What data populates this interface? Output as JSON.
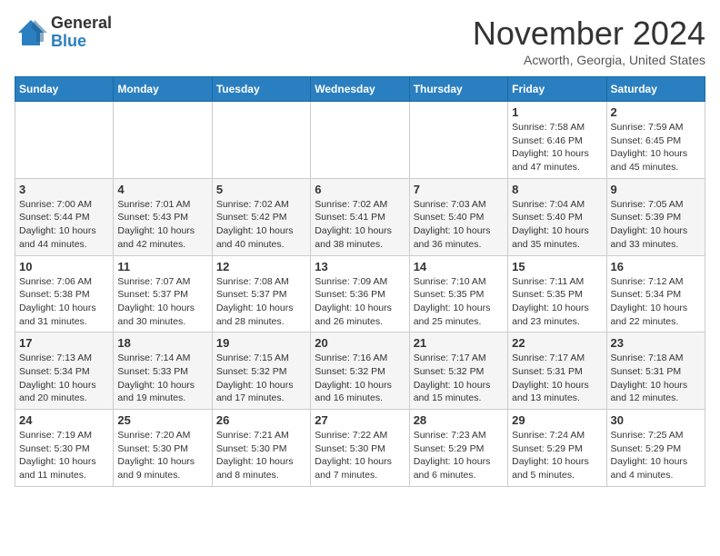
{
  "logo": {
    "general": "General",
    "blue": "Blue"
  },
  "title": "November 2024",
  "location": "Acworth, Georgia, United States",
  "weekdays": [
    "Sunday",
    "Monday",
    "Tuesday",
    "Wednesday",
    "Thursday",
    "Friday",
    "Saturday"
  ],
  "weeks": [
    [
      {
        "day": "",
        "info": ""
      },
      {
        "day": "",
        "info": ""
      },
      {
        "day": "",
        "info": ""
      },
      {
        "day": "",
        "info": ""
      },
      {
        "day": "",
        "info": ""
      },
      {
        "day": "1",
        "info": "Sunrise: 7:58 AM\nSunset: 6:46 PM\nDaylight: 10 hours and 47 minutes."
      },
      {
        "day": "2",
        "info": "Sunrise: 7:59 AM\nSunset: 6:45 PM\nDaylight: 10 hours and 45 minutes."
      }
    ],
    [
      {
        "day": "3",
        "info": "Sunrise: 7:00 AM\nSunset: 5:44 PM\nDaylight: 10 hours and 44 minutes."
      },
      {
        "day": "4",
        "info": "Sunrise: 7:01 AM\nSunset: 5:43 PM\nDaylight: 10 hours and 42 minutes."
      },
      {
        "day": "5",
        "info": "Sunrise: 7:02 AM\nSunset: 5:42 PM\nDaylight: 10 hours and 40 minutes."
      },
      {
        "day": "6",
        "info": "Sunrise: 7:02 AM\nSunset: 5:41 PM\nDaylight: 10 hours and 38 minutes."
      },
      {
        "day": "7",
        "info": "Sunrise: 7:03 AM\nSunset: 5:40 PM\nDaylight: 10 hours and 36 minutes."
      },
      {
        "day": "8",
        "info": "Sunrise: 7:04 AM\nSunset: 5:40 PM\nDaylight: 10 hours and 35 minutes."
      },
      {
        "day": "9",
        "info": "Sunrise: 7:05 AM\nSunset: 5:39 PM\nDaylight: 10 hours and 33 minutes."
      }
    ],
    [
      {
        "day": "10",
        "info": "Sunrise: 7:06 AM\nSunset: 5:38 PM\nDaylight: 10 hours and 31 minutes."
      },
      {
        "day": "11",
        "info": "Sunrise: 7:07 AM\nSunset: 5:37 PM\nDaylight: 10 hours and 30 minutes."
      },
      {
        "day": "12",
        "info": "Sunrise: 7:08 AM\nSunset: 5:37 PM\nDaylight: 10 hours and 28 minutes."
      },
      {
        "day": "13",
        "info": "Sunrise: 7:09 AM\nSunset: 5:36 PM\nDaylight: 10 hours and 26 minutes."
      },
      {
        "day": "14",
        "info": "Sunrise: 7:10 AM\nSunset: 5:35 PM\nDaylight: 10 hours and 25 minutes."
      },
      {
        "day": "15",
        "info": "Sunrise: 7:11 AM\nSunset: 5:35 PM\nDaylight: 10 hours and 23 minutes."
      },
      {
        "day": "16",
        "info": "Sunrise: 7:12 AM\nSunset: 5:34 PM\nDaylight: 10 hours and 22 minutes."
      }
    ],
    [
      {
        "day": "17",
        "info": "Sunrise: 7:13 AM\nSunset: 5:34 PM\nDaylight: 10 hours and 20 minutes."
      },
      {
        "day": "18",
        "info": "Sunrise: 7:14 AM\nSunset: 5:33 PM\nDaylight: 10 hours and 19 minutes."
      },
      {
        "day": "19",
        "info": "Sunrise: 7:15 AM\nSunset: 5:32 PM\nDaylight: 10 hours and 17 minutes."
      },
      {
        "day": "20",
        "info": "Sunrise: 7:16 AM\nSunset: 5:32 PM\nDaylight: 10 hours and 16 minutes."
      },
      {
        "day": "21",
        "info": "Sunrise: 7:17 AM\nSunset: 5:32 PM\nDaylight: 10 hours and 15 minutes."
      },
      {
        "day": "22",
        "info": "Sunrise: 7:17 AM\nSunset: 5:31 PM\nDaylight: 10 hours and 13 minutes."
      },
      {
        "day": "23",
        "info": "Sunrise: 7:18 AM\nSunset: 5:31 PM\nDaylight: 10 hours and 12 minutes."
      }
    ],
    [
      {
        "day": "24",
        "info": "Sunrise: 7:19 AM\nSunset: 5:30 PM\nDaylight: 10 hours and 11 minutes."
      },
      {
        "day": "25",
        "info": "Sunrise: 7:20 AM\nSunset: 5:30 PM\nDaylight: 10 hours and 9 minutes."
      },
      {
        "day": "26",
        "info": "Sunrise: 7:21 AM\nSunset: 5:30 PM\nDaylight: 10 hours and 8 minutes."
      },
      {
        "day": "27",
        "info": "Sunrise: 7:22 AM\nSunset: 5:30 PM\nDaylight: 10 hours and 7 minutes."
      },
      {
        "day": "28",
        "info": "Sunrise: 7:23 AM\nSunset: 5:29 PM\nDaylight: 10 hours and 6 minutes."
      },
      {
        "day": "29",
        "info": "Sunrise: 7:24 AM\nSunset: 5:29 PM\nDaylight: 10 hours and 5 minutes."
      },
      {
        "day": "30",
        "info": "Sunrise: 7:25 AM\nSunset: 5:29 PM\nDaylight: 10 hours and 4 minutes."
      }
    ]
  ]
}
